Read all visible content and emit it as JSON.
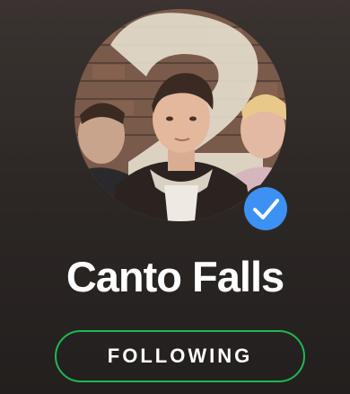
{
  "artist": {
    "name": "Canto Falls",
    "verified": true,
    "avatar_icon": "artist-photo"
  },
  "follow_button": {
    "label": "FOLLOWING",
    "state": "following"
  },
  "colors": {
    "accent": "#1db954",
    "verified_badge": "#3d91f4",
    "background": "#2d2826",
    "text": "#ffffff"
  }
}
